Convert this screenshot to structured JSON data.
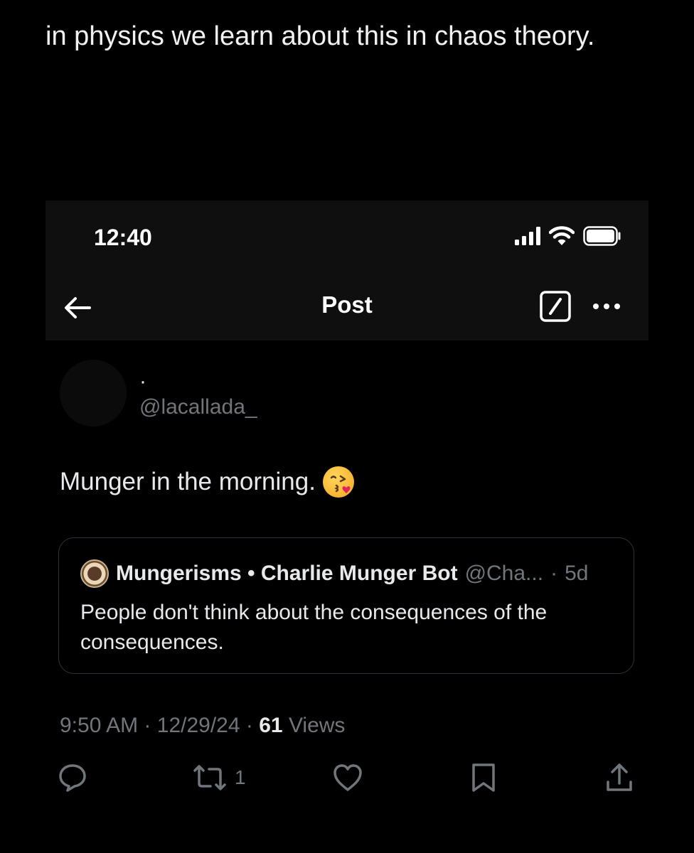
{
  "caption": "in physics we learn about this in chaos theory.",
  "status_bar": {
    "time": "12:40",
    "icons": [
      "signal-icon",
      "wifi-icon",
      "battery-icon"
    ]
  },
  "nav": {
    "title": "Post",
    "icons": [
      "back-arrow-icon",
      "compose-icon",
      "more-icon"
    ]
  },
  "author": {
    "display_name": "·",
    "handle": "@lacallada_"
  },
  "post": {
    "text": "Munger in the morning.",
    "emoji": "kissing-face-emoji"
  },
  "quote": {
    "name": "Mungerisms • Charlie Munger Bot",
    "handle": "@Cha...",
    "separator": "·",
    "age": "5d",
    "text": "People don't think about the consequences of the consequences."
  },
  "meta": {
    "time": "9:50 AM",
    "dot1": "·",
    "date": "12/29/24",
    "dot2": "·",
    "views": "61",
    "views_label": "Views"
  },
  "actions": {
    "reply_icon": "reply-icon",
    "repost_icon": "repost-icon",
    "repost_count": "1",
    "like_icon": "heart-icon",
    "bookmark_icon": "bookmark-icon",
    "share_icon": "share-icon"
  },
  "colors": {
    "background": "#000000",
    "text": "#e7e9ea",
    "muted": "#71767b",
    "border": "#2f3336"
  }
}
